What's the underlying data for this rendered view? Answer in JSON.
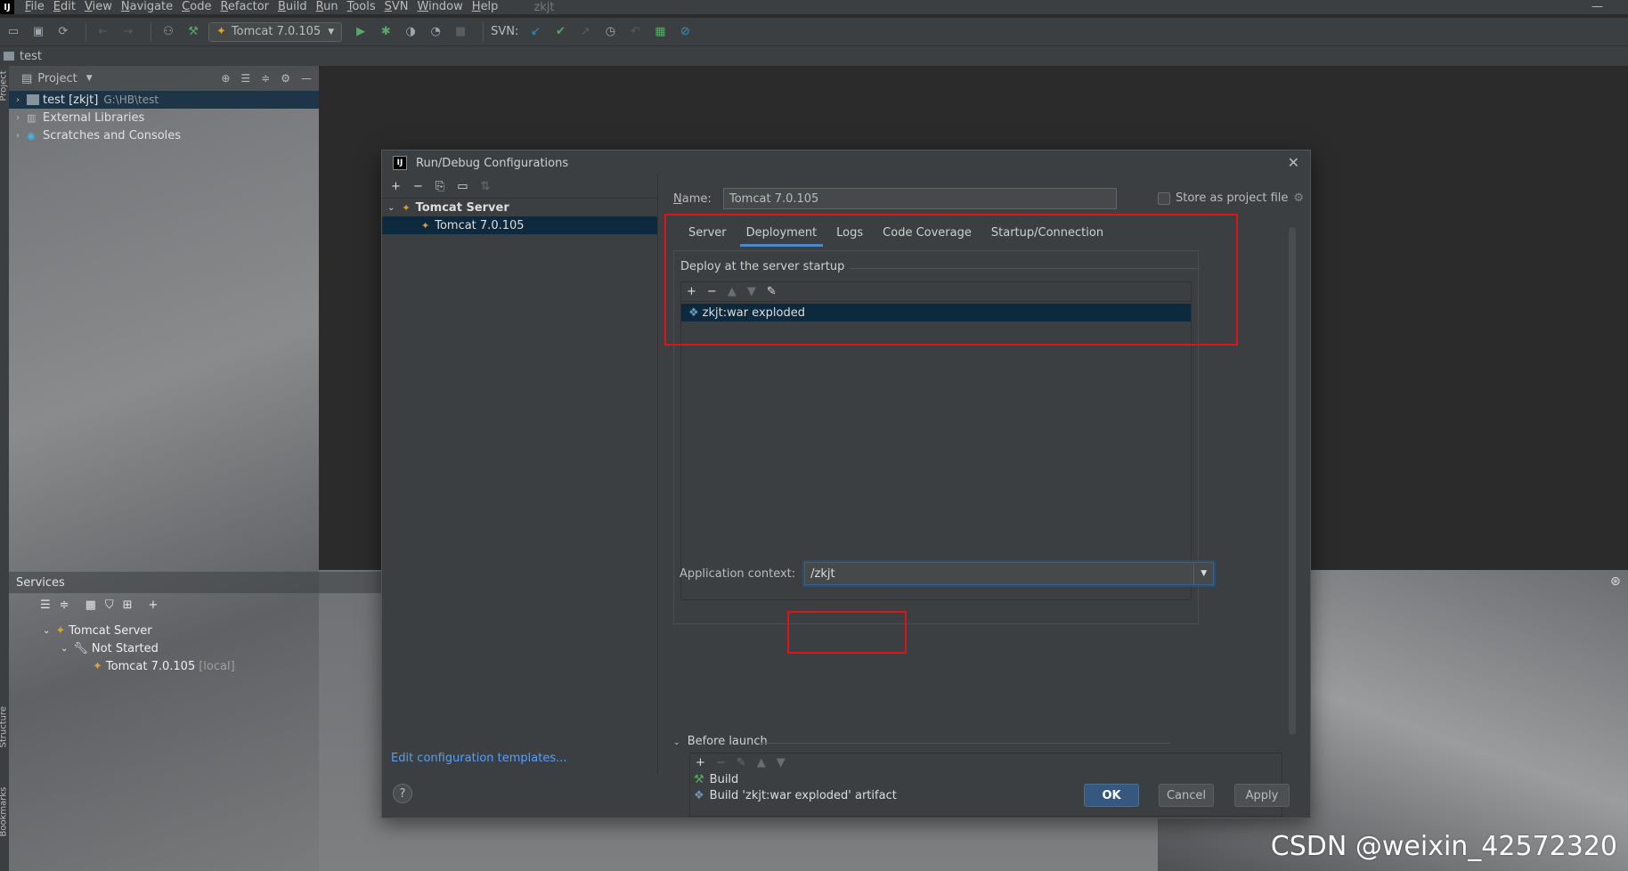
{
  "menubar": {
    "logo": "IJ",
    "items": [
      "File",
      "Edit",
      "View",
      "Navigate",
      "Code",
      "Refactor",
      "Build",
      "Run",
      "Tools",
      "SVN",
      "Window",
      "Help"
    ],
    "window_title": "zkjt"
  },
  "toolbar": {
    "run_config": "Tomcat 7.0.105",
    "svn_label": "SVN:"
  },
  "navbar": {
    "project": "test"
  },
  "left_strip": {
    "project_tab": "Project",
    "structure_tab": "Structure",
    "bookmarks_tab": "Bookmarks"
  },
  "project_panel": {
    "title": "Project",
    "items": [
      {
        "label": "test [zkjt]",
        "path": "G:\\HB\\test"
      },
      {
        "label": "External Libraries"
      },
      {
        "label": "Scratches and Consoles"
      }
    ]
  },
  "services": {
    "title": "Services",
    "tree": [
      {
        "label": "Tomcat Server"
      },
      {
        "label": "Not Started"
      },
      {
        "label": "Tomcat 7.0.105",
        "suffix": "[local]"
      }
    ]
  },
  "dialog": {
    "title": "Run/Debug Configurations",
    "logo": "IJ",
    "config_tree": {
      "group": "Tomcat Server",
      "item": "Tomcat 7.0.105"
    },
    "edit_templates": "Edit configuration templates...",
    "name_label": "Name:",
    "name_value": "Tomcat 7.0.105",
    "store_label": "Store as project file",
    "tabs": [
      "Server",
      "Deployment",
      "Logs",
      "Code Coverage",
      "Startup/Connection"
    ],
    "active_tab": "Deployment",
    "deploy_title": "Deploy at the server startup",
    "artifact": "zkjt:war exploded",
    "app_context_label": "Application context:",
    "app_context_value": "/zkjt",
    "before_launch": {
      "title": "Before launch",
      "items": [
        "Build",
        "Build 'zkjt:war exploded' artifact"
      ]
    },
    "buttons": {
      "ok": "OK",
      "cancel": "Cancel",
      "apply": "Apply",
      "help": "?"
    }
  },
  "watermark": "CSDN @weixin_42572320",
  "colors": {
    "accent": "#4a88c7",
    "selection": "#0d293e",
    "highlight": "#d9151b",
    "primary_button": "#365880"
  }
}
